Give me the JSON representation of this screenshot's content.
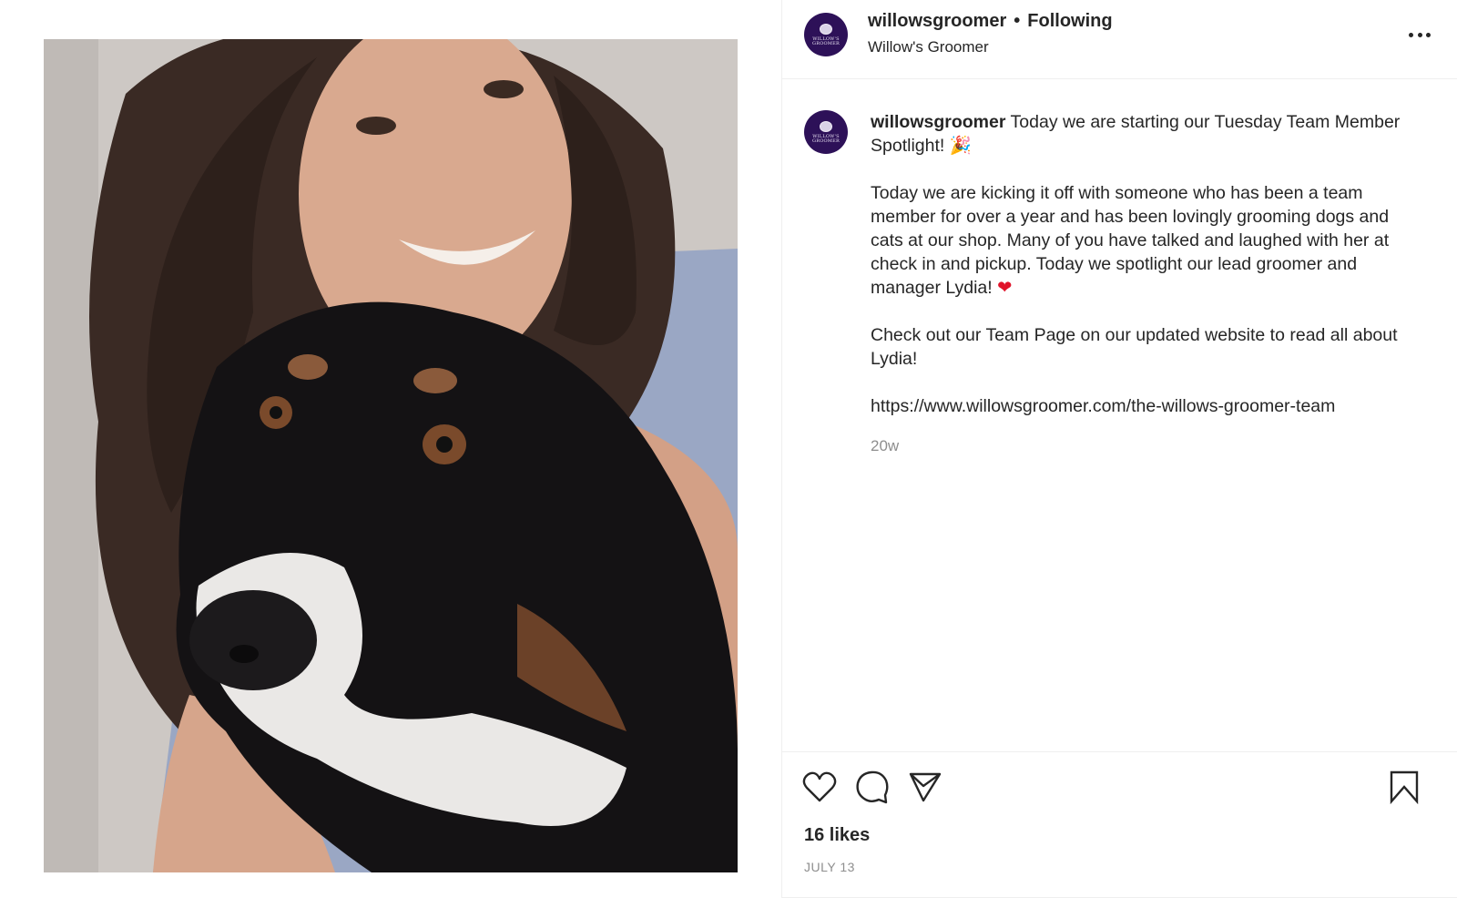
{
  "post": {
    "image_alt": "Woman smiling behind a black, tan and white long-haired dog",
    "author": {
      "username": "willowsgroomer",
      "display_name": "Willow's Groomer",
      "follow_status": "Following",
      "separator": "•",
      "avatar_text_line1": "WILLOW'S",
      "avatar_text_line2": "GROOMER",
      "brand_color": "#2d1158"
    },
    "caption": {
      "username": "willowsgroomer",
      "intro": "Today we are starting our Tuesday Team Member Spotlight!",
      "intro_emoji": "🎉",
      "paragraph_2": "Today we are kicking it off with someone who has been a team member for over a year and has been lovingly grooming dogs and cats at our shop. Many of you have talked and laughed with her at check in and pickup. Today we spotlight our lead groomer and manager Lydia!",
      "paragraph_2_emoji": "❤",
      "paragraph_3": "Check out our Team Page on our updated website to read all about Lydia!",
      "link": "https://www.willowsgroomer.com/the-willows-groomer-team",
      "relative_time": "20w"
    },
    "actions": {
      "like_icon": "heart-outline-icon",
      "comment_icon": "comment-bubble-icon",
      "share_icon": "paper-plane-icon",
      "save_icon": "bookmark-outline-icon",
      "more_icon": "more-horizontal-icon"
    },
    "likes_text": "16 likes",
    "date": "JULY 13"
  }
}
